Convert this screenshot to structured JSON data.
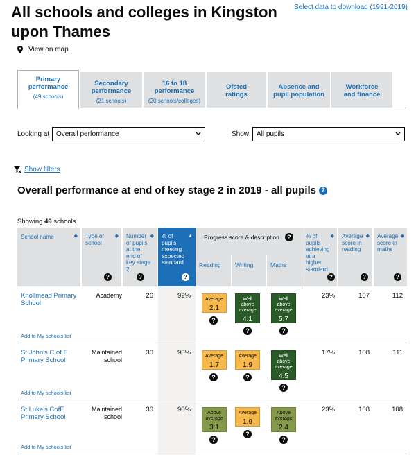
{
  "header": {
    "title": "All schools and colleges in Kingston upon Thames",
    "download_link": "Select data to download (1991-2019)",
    "view_map": "View on map"
  },
  "tabs": [
    {
      "label": "Primary performance",
      "sub": "(49 schools)",
      "active": true
    },
    {
      "label": "Secondary performance",
      "sub": "(21 schools)",
      "active": false
    },
    {
      "label": "16 to 18 performance",
      "sub": "(20 schools/colleges)",
      "active": false
    },
    {
      "label": "Ofsted ratings",
      "sub": "",
      "active": false
    },
    {
      "label": "Absence and pupil population",
      "sub": "",
      "active": false
    },
    {
      "label": "Workforce and finance",
      "sub": "",
      "active": false
    }
  ],
  "filters": {
    "looking_at_label": "Looking at",
    "looking_at_value": "Overall performance",
    "show_label": "Show",
    "show_value": "All pupils",
    "show_filters": "Show filters"
  },
  "section_title": "Overall performance at end of key stage 2 in 2019 - all pupils",
  "showing": {
    "prefix": "Showing",
    "count": "49",
    "suffix": "schools"
  },
  "table": {
    "headers": {
      "school_name": "School name",
      "type": "Type of school",
      "number": "Number of pupils at the end of key stage 2",
      "pct_expected": "% of pupils meeting expected standard",
      "progress": "Progress score & description",
      "reading": "Reading",
      "writing": "Writing",
      "maths": "Maths",
      "pct_higher": "% of pupils achieving at a higher standard",
      "avg_reading": "Average score in reading",
      "avg_maths": "Average score in maths"
    },
    "add_label": "Add to My schools list",
    "rows": [
      {
        "name": "Knollmead Primary School",
        "type": "Academy",
        "number": "26",
        "pct_expected": "92%",
        "reading": {
          "desc": "Average",
          "score": "2.1",
          "level": "average"
        },
        "writing": {
          "desc": "Well above average",
          "score": "4.1",
          "level": "well-above"
        },
        "maths": {
          "desc": "Well above average",
          "score": "5.7",
          "level": "well-above"
        },
        "pct_higher": "23%",
        "avg_reading": "107",
        "avg_maths": "112"
      },
      {
        "name": "St John's C of E Primary School",
        "type": "Maintained school",
        "number": "30",
        "pct_expected": "90%",
        "reading": {
          "desc": "Average",
          "score": "1.7",
          "level": "average"
        },
        "writing": {
          "desc": "Average",
          "score": "1.9",
          "level": "average"
        },
        "maths": {
          "desc": "Well above average",
          "score": "4.5",
          "level": "well-above"
        },
        "pct_higher": "17%",
        "avg_reading": "108",
        "avg_maths": "111"
      },
      {
        "name": "St Luke's CofE Primary School",
        "type": "Maintained school",
        "number": "30",
        "pct_expected": "90%",
        "reading": {
          "desc": "Above average",
          "score": "3.1",
          "level": "above"
        },
        "writing": {
          "desc": "Average",
          "score": "1.9",
          "level": "average"
        },
        "maths": {
          "desc": "Above average",
          "score": "2.4",
          "level": "above"
        },
        "pct_higher": "23%",
        "avg_reading": "108",
        "avg_maths": "108"
      }
    ]
  },
  "colors": {
    "link": "#1d70b8",
    "average": "#f7b84b",
    "well_above": "#2a5a27",
    "above": "#85994b",
    "header_bg": "#dee0e2"
  }
}
